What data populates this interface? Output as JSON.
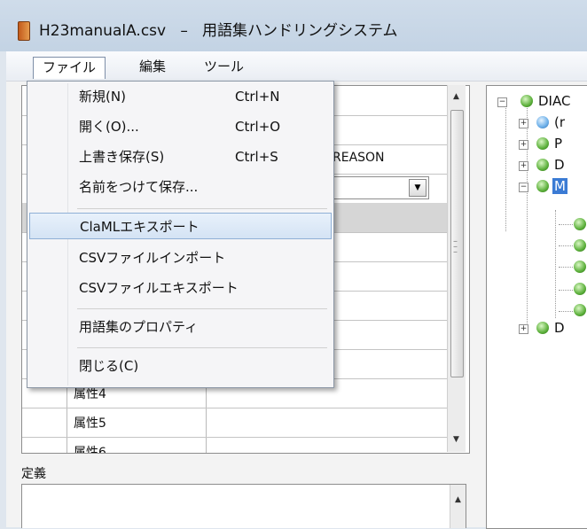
{
  "window": {
    "filename": "H23manualA.csv",
    "separator": "–",
    "app_name": "用語集ハンドリングシステム"
  },
  "menubar": {
    "file": "ファイル",
    "edit": "編集",
    "tools": "ツール"
  },
  "file_menu": {
    "items": [
      {
        "label": "新規(N)",
        "shortcut": "Ctrl+N"
      },
      {
        "label": "開く(O)...",
        "shortcut": "Ctrl+O"
      },
      {
        "label": "上書き保存(S)",
        "shortcut": "Ctrl+S"
      },
      {
        "label": "名前をつけて保存..."
      },
      {
        "label": "ClaMLエキスポート",
        "highlighted": true
      },
      {
        "label": "CSVファイルインポート"
      },
      {
        "label": "CSVファイルエキスポート"
      },
      {
        "label": "用語集のプロパティ"
      },
      {
        "label": "閉じる(C)"
      }
    ]
  },
  "grid": {
    "visible_value": "REASON",
    "rows": [
      {
        "label": "属性4"
      },
      {
        "label": "属性5"
      },
      {
        "label": "属性6"
      }
    ]
  },
  "definition": {
    "label": "定義",
    "value": ""
  },
  "tree": {
    "nodes": [
      {
        "label": "DIAC"
      },
      {
        "label": "(r"
      },
      {
        "label": "P"
      },
      {
        "label": "D"
      },
      {
        "label": "M",
        "selected": true
      },
      {
        "label": "D"
      }
    ]
  },
  "colors": {
    "title_bar": "#c9d8e8",
    "highlight": "#d4e3f4",
    "tree_selection": "#3b7bd4",
    "node_icon": "#5cb03b"
  }
}
